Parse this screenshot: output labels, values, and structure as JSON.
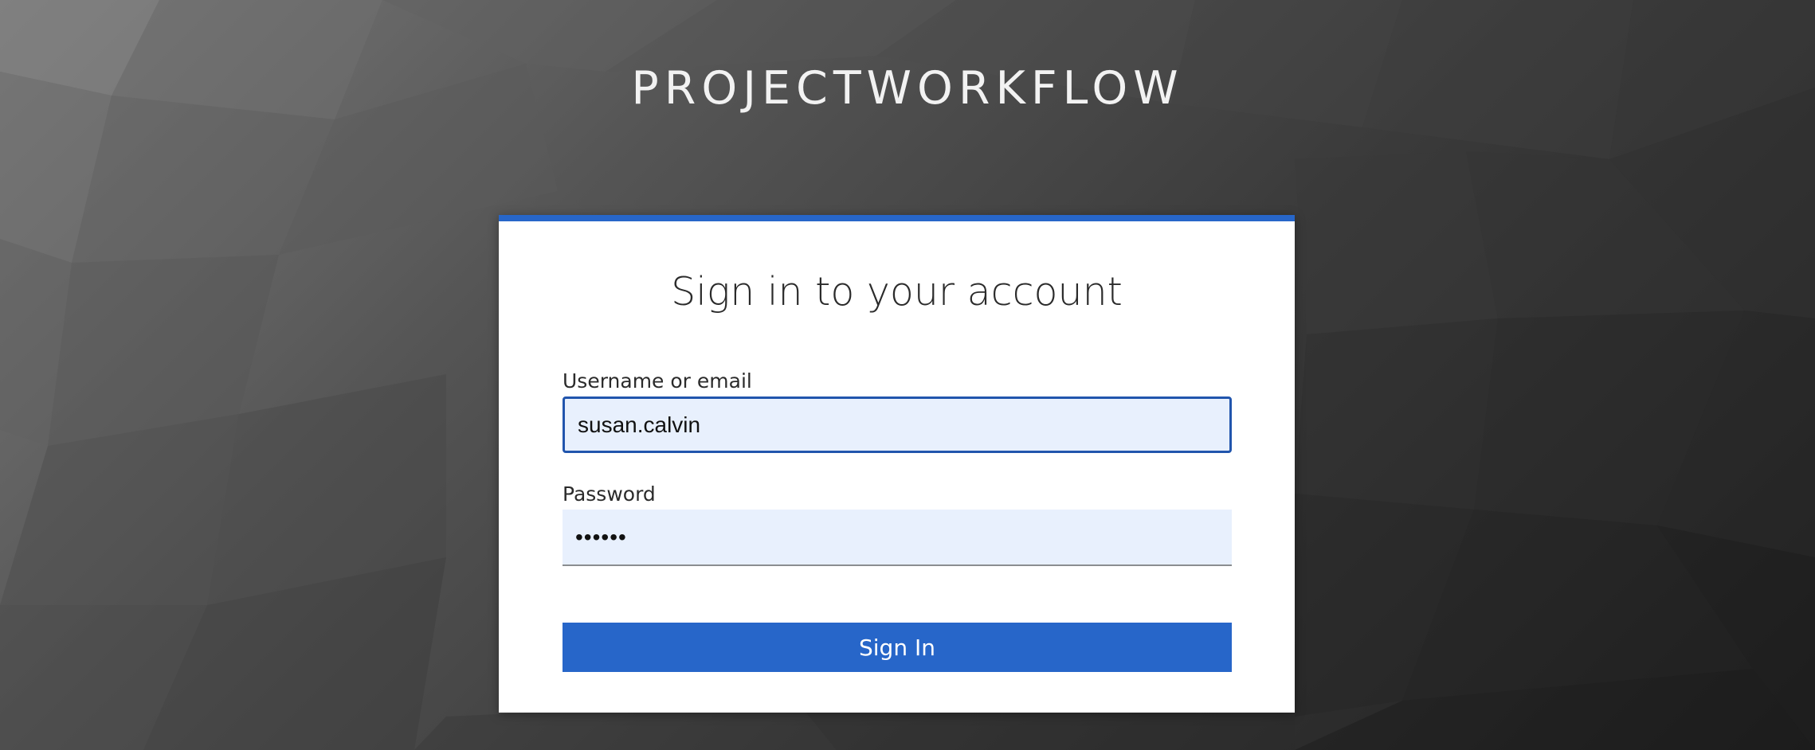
{
  "brand": {
    "name": "PROJECTWORKFLOW"
  },
  "login": {
    "title": "Sign in to your account",
    "username_label": "Username or email",
    "username_value": "susan.calvin",
    "password_label": "Password",
    "password_value": "••••••",
    "submit_label": "Sign In"
  },
  "colors": {
    "accent": "#2766c9",
    "input_background": "#e8f0fd",
    "focus_border": "#2155ad",
    "card_background": "#ffffff"
  }
}
